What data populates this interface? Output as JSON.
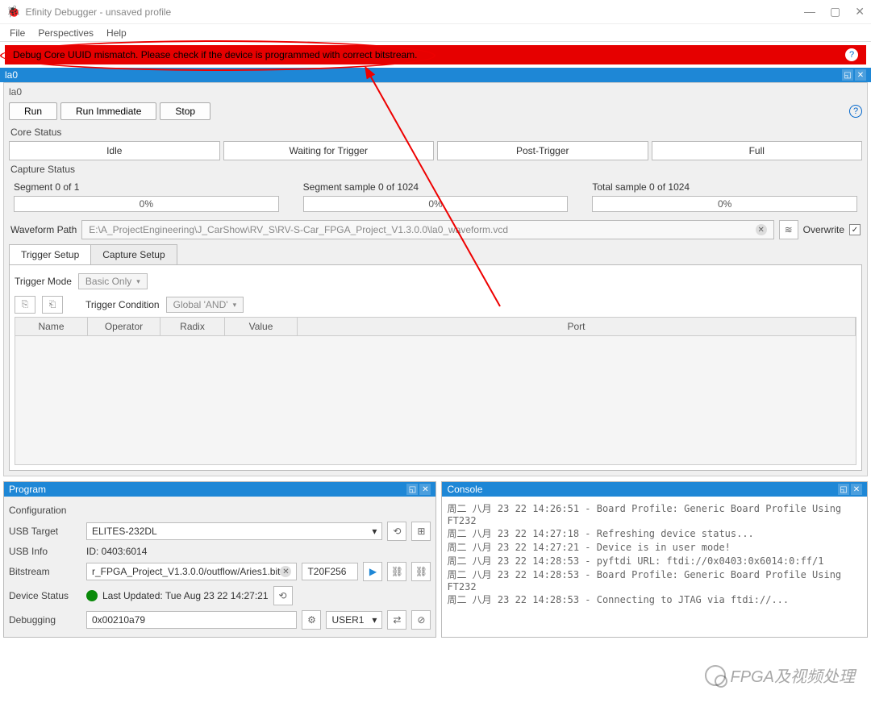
{
  "window": {
    "title": "Efinity Debugger - unsaved profile"
  },
  "menu": {
    "file": "File",
    "perspectives": "Perspectives",
    "help": "Help"
  },
  "error": {
    "msg": "Debug Core UUID mismatch. Please check if the device is programmed with correct bitstream."
  },
  "la0": {
    "title": "la0",
    "sublabel": "la0",
    "run": "Run",
    "run_imm": "Run Immediate",
    "stop": "Stop",
    "core_status": "Core Status",
    "statuses": {
      "idle": "Idle",
      "waiting": "Waiting for Trigger",
      "post": "Post-Trigger",
      "full": "Full"
    },
    "capture_status": "Capture Status",
    "seg_label": "Segment 0 of 1",
    "seg_pct": "0%",
    "ssample_label": "Segment sample 0 of 1024",
    "ssample_pct": "0%",
    "tsample_label": "Total sample 0 of 1024",
    "tsample_pct": "0%",
    "wfpath_label": "Waveform Path",
    "wfpath": "E:\\A_ProjectEngineering\\J_CarShow\\RV_S\\RV-S-Car_FPGA_Project_V1.3.0.0\\la0_waveform.vcd",
    "overwrite": "Overwrite",
    "tab_trigger": "Trigger Setup",
    "tab_capture": "Capture Setup",
    "trigger_mode_label": "Trigger Mode",
    "trigger_mode": "Basic Only",
    "trigger_cond_label": "Trigger Condition",
    "trigger_cond": "Global 'AND'",
    "cols": {
      "name": "Name",
      "operator": "Operator",
      "radix": "Radix",
      "value": "Value",
      "port": "Port"
    }
  },
  "program": {
    "title": "Program",
    "configuration": "Configuration",
    "usb_target_label": "USB Target",
    "usb_target": "ELITES-232DL",
    "usb_info_label": "USB Info",
    "usb_info": "ID: 0403:6014",
    "bitstream_label": "Bitstream",
    "bitstream": "r_FPGA_Project_V1.3.0.0/outflow/Aries1.bit",
    "device": "T20F256",
    "device_status_label": "Device Status",
    "device_status": "Last Updated: Tue Aug 23 22 14:27:21",
    "debugging_label": "Debugging",
    "debugging": "0x00210a79",
    "user": "USER1"
  },
  "console": {
    "title": "Console",
    "text": "周二 八月 23 22 14:26:51 - Board Profile: Generic Board Profile Using FT232\n周二 八月 23 22 14:27:18 - Refreshing device status...\n周二 八月 23 22 14:27:21 - Device is in user mode!\n周二 八月 23 22 14:28:53 - pyftdi URL: ftdi://0x0403:0x6014:0:ff/1\n周二 八月 23 22 14:28:53 - Board Profile: Generic Board Profile Using FT232\n周二 八月 23 22 14:28:53 - Connecting to JTAG via ftdi://..."
  },
  "watermark": "FPGA及视频处理"
}
